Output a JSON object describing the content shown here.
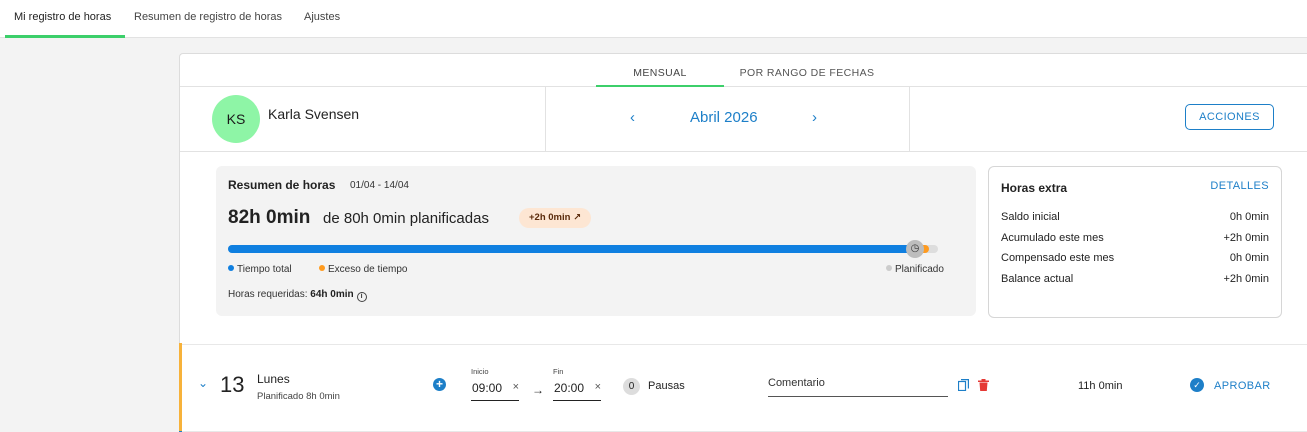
{
  "nav": {
    "tabs": [
      {
        "label": "Mi registro de horas",
        "active": true
      },
      {
        "label": "Resumen de registro de horas"
      },
      {
        "label": "Ajustes"
      }
    ]
  },
  "view_tabs": [
    {
      "label": "MENSUAL",
      "active": true
    },
    {
      "label": "POR RANGO DE FECHAS"
    }
  ],
  "user": {
    "initials": "KS",
    "name": "Karla Svensen"
  },
  "period": {
    "month": "Abril 2026",
    "prev_icon": "chevron-left-icon",
    "next_icon": "chevron-right-icon"
  },
  "actions_label": "ACCIONES",
  "summary": {
    "title": "Resumen de horas",
    "range": "01/04 - 14/04",
    "worked": "82h 0min",
    "planned_text": "de 80h 0min planificadas",
    "badge": "+2h 0min ↗",
    "progress_fraction": 0.976,
    "excess_fraction": 0.012,
    "legend": {
      "total": "Tiempo total",
      "excess": "Exceso de tiempo",
      "planned": "Planificado"
    },
    "required_label": "Horas requeridas:",
    "required_value": "64h 0min"
  },
  "overtime": {
    "title": "Horas extra",
    "details_label": "DETALLES",
    "rows": [
      {
        "label": "Saldo inicial",
        "value": "0h 0min"
      },
      {
        "label": "Acumulado este mes",
        "value": "+2h 0min"
      },
      {
        "label": "Compensado este mes",
        "value": "0h 0min"
      },
      {
        "label": "Balance actual",
        "value": "+2h 0min"
      }
    ]
  },
  "day": {
    "number": "13",
    "name": "Lunes",
    "planned": "Planificado 8h 0min",
    "start_label": "Inicio",
    "start": "09:00",
    "end_label": "Fin",
    "end": "20:00",
    "pauses_count": "0",
    "pauses_label": "Pausas",
    "comment_placeholder": "Comentario",
    "total": "11h 0min",
    "approve_label": "APROBAR"
  },
  "colors": {
    "accent": "#1d7fc8",
    "active_tab": "#3ccf6a",
    "progress": "#0f7fe0",
    "excess": "#ff9b1f",
    "avatar": "#8ef5a6"
  }
}
